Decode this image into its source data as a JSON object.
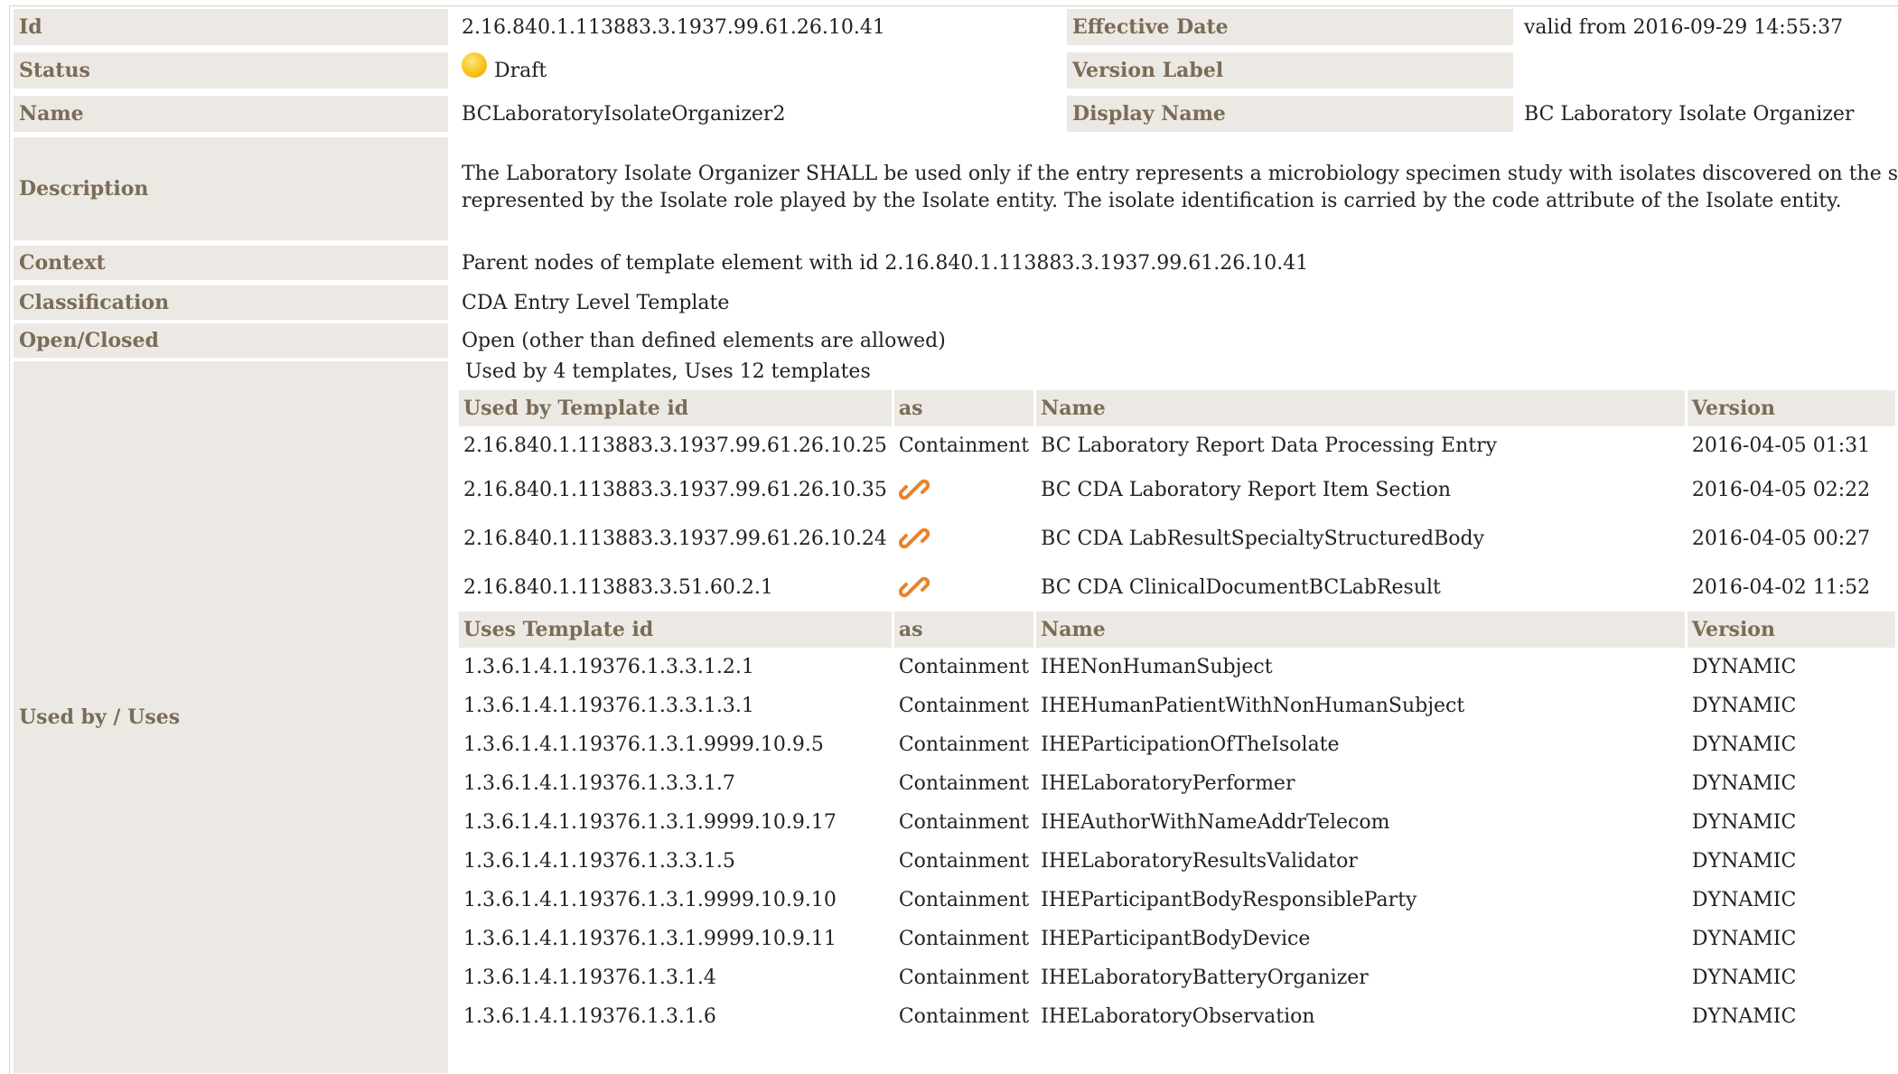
{
  "rows": {
    "id": {
      "label": "Id",
      "value": "2.16.840.1.113883.3.1937.99.61.26.10.41"
    },
    "effective_date": {
      "label": "Effective Date",
      "value": "valid from 2016-09-29 14:55:37"
    },
    "status": {
      "label": "Status",
      "value": "Draft",
      "icon": "draft-status-icon"
    },
    "version_label": {
      "label": "Version Label",
      "value": ""
    },
    "name": {
      "label": "Name",
      "value": "BCLaboratoryIsolateOrganizer2"
    },
    "display_name": {
      "label": "Display Name",
      "value": "BC Laboratory Isolate Organizer"
    },
    "description": {
      "label": "Description",
      "line1": "The Laboratory Isolate Organizer SHALL be used only if the entry represents a microbiology specimen study with isolates discovered on the specimen. The is",
      "line2": "represented by the Isolate role played by the Isolate entity. The isolate identification is carried by the code attribute of the Isolate entity."
    },
    "context": {
      "label": "Context",
      "value": "Parent nodes of template element with id 2.16.840.1.113883.3.1937.99.61.26.10.41"
    },
    "classification": {
      "label": "Classification",
      "value": "CDA Entry Level Template"
    },
    "open_closed": {
      "label": "Open/Closed",
      "value": "Open (other than defined elements are allowed)"
    },
    "used_by_uses": {
      "label": "Used by / Uses"
    }
  },
  "usage": {
    "summary": "Used by 4 templates, Uses 12 templates",
    "used_by_headers": {
      "id": "Used by Template id",
      "as": "as",
      "name": "Name",
      "version": "Version"
    },
    "used_by": [
      {
        "id": "2.16.840.1.113883.3.1937.99.61.26.10.25",
        "as": "Containment",
        "name": "BC Laboratory Report Data Processing Entry",
        "version": "2016-04-05 01:31"
      },
      {
        "id": "2.16.840.1.113883.3.1937.99.61.26.10.35",
        "as": "",
        "as_icon": "link-icon",
        "name": "BC CDA Laboratory Report Item Section",
        "version": "2016-04-05 02:22"
      },
      {
        "id": "2.16.840.1.113883.3.1937.99.61.26.10.24",
        "as": "",
        "as_icon": "link-icon",
        "name": "BC CDA LabResultSpecialtyStructuredBody",
        "version": "2016-04-05 00:27"
      },
      {
        "id": "2.16.840.1.113883.3.51.60.2.1",
        "as": "",
        "as_icon": "link-icon",
        "name": "BC CDA ClinicalDocumentBCLabResult",
        "version": "2016-04-02 11:52"
      }
    ],
    "uses_headers": {
      "id": "Uses Template id",
      "as": "as",
      "name": "Name",
      "version": "Version"
    },
    "uses": [
      {
        "id": "1.3.6.1.4.1.19376.1.3.3.1.2.1",
        "as": "Containment",
        "name": "IHENonHumanSubject",
        "version": "DYNAMIC"
      },
      {
        "id": "1.3.6.1.4.1.19376.1.3.3.1.3.1",
        "as": "Containment",
        "name": "IHEHumanPatientWithNonHumanSubject",
        "version": "DYNAMIC"
      },
      {
        "id": "1.3.6.1.4.1.19376.1.3.1.9999.10.9.5",
        "as": "Containment",
        "name": "IHEParticipationOfTheIsolate",
        "version": "DYNAMIC"
      },
      {
        "id": "1.3.6.1.4.1.19376.1.3.3.1.7",
        "as": "Containment",
        "name": "IHELaboratoryPerformer",
        "version": "DYNAMIC"
      },
      {
        "id": "1.3.6.1.4.1.19376.1.3.1.9999.10.9.17",
        "as": "Containment",
        "name": "IHEAuthorWithNameAddrTelecom",
        "version": "DYNAMIC"
      },
      {
        "id": "1.3.6.1.4.1.19376.1.3.3.1.5",
        "as": "Containment",
        "name": "IHELaboratoryResultsValidator",
        "version": "DYNAMIC"
      },
      {
        "id": "1.3.6.1.4.1.19376.1.3.1.9999.10.9.10",
        "as": "Containment",
        "name": "IHEParticipantBodyResponsibleParty",
        "version": "DYNAMIC"
      },
      {
        "id": "1.3.6.1.4.1.19376.1.3.1.9999.10.9.11",
        "as": "Containment",
        "name": "IHEParticipantBodyDevice",
        "version": "DYNAMIC"
      },
      {
        "id": "1.3.6.1.4.1.19376.1.3.1.4",
        "as": "Containment",
        "name": "IHELaboratoryBatteryOrganizer",
        "version": "DYNAMIC"
      },
      {
        "id": "1.3.6.1.4.1.19376.1.3.1.6",
        "as": "Containment",
        "name": "IHELaboratoryObservation",
        "version": "DYNAMIC"
      }
    ]
  },
  "colors": {
    "label_bg": "#ece9e4",
    "label_text": "#7a6c56",
    "link_icon": "#e8832a"
  }
}
